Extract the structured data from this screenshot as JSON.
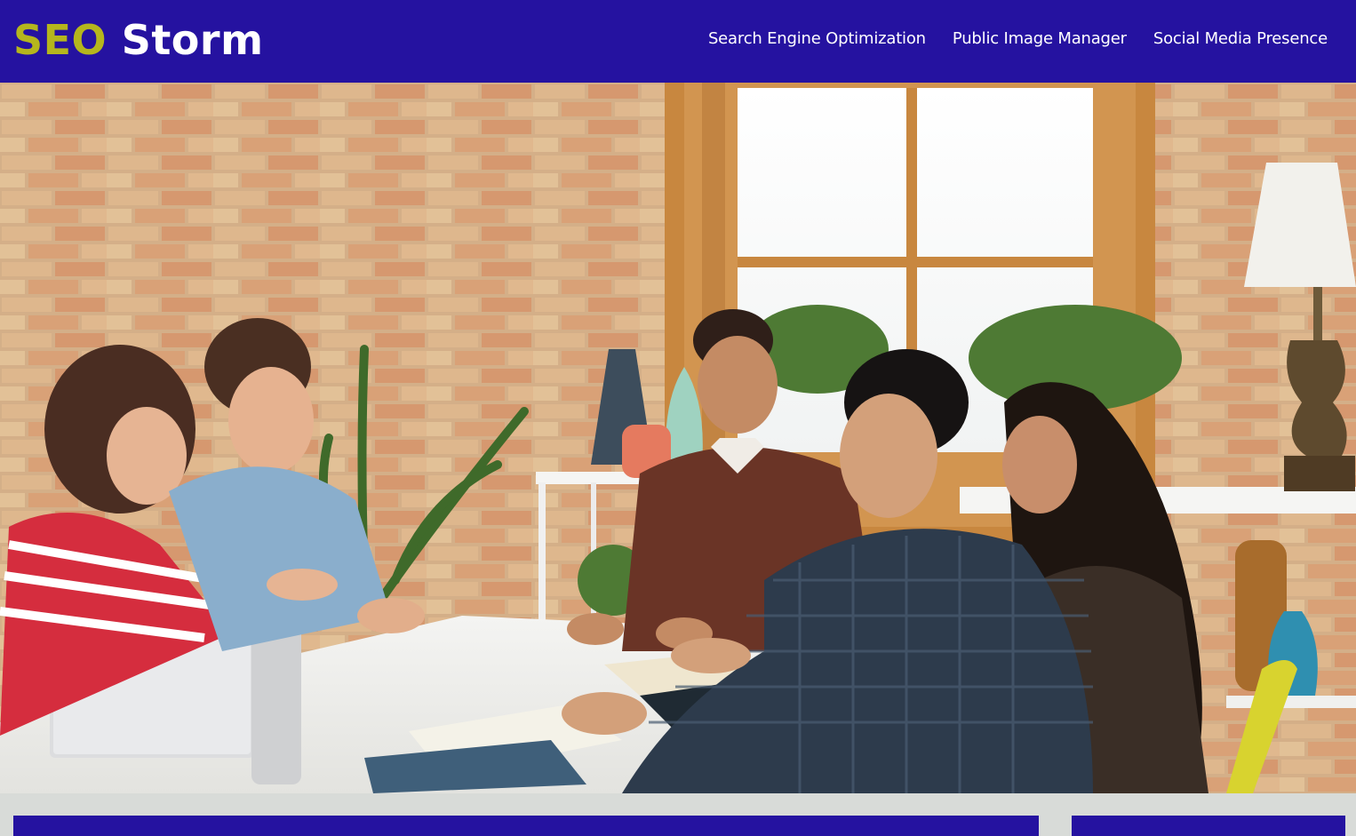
{
  "header": {
    "logo_part1": "SEO",
    "logo_part2": "Storm",
    "nav": [
      {
        "label": "Search Engine Optimization"
      },
      {
        "label": "Public Image Manager"
      },
      {
        "label": "Social Media Presence"
      }
    ]
  },
  "hero": {
    "description": "Team meeting around a table in a brick-walled office"
  },
  "colors": {
    "brand": "#2512a0",
    "logo_accent": "#b5b61d",
    "page_background": "#d8dbd8"
  }
}
